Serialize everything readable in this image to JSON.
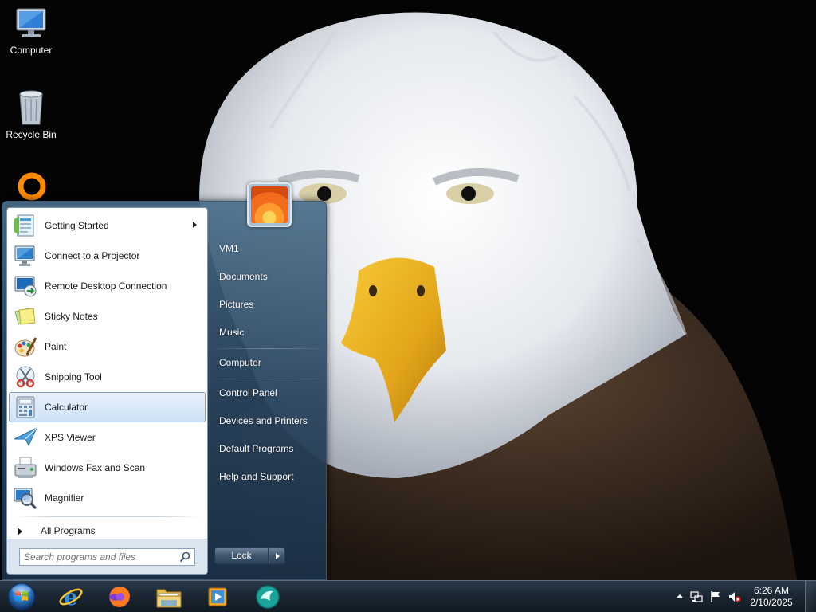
{
  "desktop": {
    "icons": [
      {
        "label": "Computer",
        "icon": "computer-icon"
      },
      {
        "label": "Recycle Bin",
        "icon": "recycle-bin-icon"
      },
      {
        "label": "",
        "icon": "vlc-icon"
      }
    ]
  },
  "start_menu": {
    "programs": [
      {
        "label": "Getting Started",
        "icon": "getting-started-icon",
        "has_submenu": true
      },
      {
        "label": "Connect to a Projector",
        "icon": "projector-icon"
      },
      {
        "label": "Remote Desktop Connection",
        "icon": "remote-desktop-icon"
      },
      {
        "label": "Sticky Notes",
        "icon": "sticky-notes-icon"
      },
      {
        "label": "Paint",
        "icon": "paint-icon"
      },
      {
        "label": "Snipping Tool",
        "icon": "snipping-tool-icon"
      },
      {
        "label": "Calculator",
        "icon": "calculator-icon",
        "selected": true
      },
      {
        "label": "XPS Viewer",
        "icon": "xps-viewer-icon"
      },
      {
        "label": "Windows Fax and Scan",
        "icon": "fax-scan-icon"
      },
      {
        "label": "Magnifier",
        "icon": "magnifier-icon"
      }
    ],
    "all_programs": "All Programs",
    "search_placeholder": "Search programs and files",
    "right_links": [
      "VM1",
      "Documents",
      "Pictures",
      "Music",
      "Computer",
      "Control Panel",
      "Devices and Printers",
      "Default Programs",
      "Help and Support"
    ],
    "lock_label": "Lock"
  },
  "taskbar": {
    "pinned": [
      "internet-explorer-icon",
      "firefox-icon",
      "file-explorer-icon",
      "media-player-icon",
      "app-icon"
    ],
    "clock": {
      "time": "6:26 AM",
      "date": "2/10/2025"
    },
    "tray": [
      "show-hidden-icons-icon",
      "network-icon",
      "action-center-flag-icon",
      "volume-muted-icon"
    ]
  },
  "colors": {
    "accent": "#7da2ce",
    "start_menu_glass": "#3a5a78",
    "taskbar": "#1b2733"
  }
}
